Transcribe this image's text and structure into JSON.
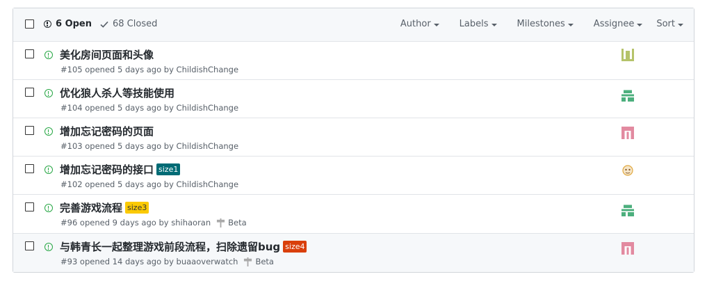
{
  "header": {
    "open_label": "6 Open",
    "closed_label": "68 Closed",
    "filters": [
      "Author",
      "Labels",
      "Milestones",
      "Assignee",
      "Sort"
    ]
  },
  "colors": {
    "open_green": "#28a745",
    "label_size1": "#006b75",
    "label_size3": "#fbca04",
    "label_size4": "#d93f0b"
  },
  "issues": [
    {
      "title": "美化房间页面和头像",
      "meta": "#105 opened 5 days ago by ChildishChange",
      "label": "",
      "milestone": "",
      "avatar": "avatar-olive"
    },
    {
      "title": "优化狼人杀人等技能使用",
      "meta": "#104 opened 5 days ago by ChildishChange",
      "label": "",
      "milestone": "",
      "avatar": "avatar-green"
    },
    {
      "title": "增加忘记密码的页面",
      "meta": "#103 opened 5 days ago by ChildishChange",
      "label": "",
      "milestone": "",
      "avatar": "avatar-pink"
    },
    {
      "title": "增加忘记密码的接口",
      "meta": "#102 opened 5 days ago by ChildishChange",
      "label": "size1",
      "milestone": "",
      "avatar": "avatar-orange"
    },
    {
      "title": "完善游戏流程",
      "meta": "#96 opened 9 days ago by shihaoran",
      "label": "size3",
      "milestone": "Beta",
      "avatar": "avatar-green"
    },
    {
      "title": "与韩青长一起整理游戏前段流程，扫除遗留bug",
      "meta": "#93 opened 14 days ago by buaaoverwatch",
      "label": "size4",
      "milestone": "Beta",
      "avatar": "avatar-pink"
    }
  ]
}
